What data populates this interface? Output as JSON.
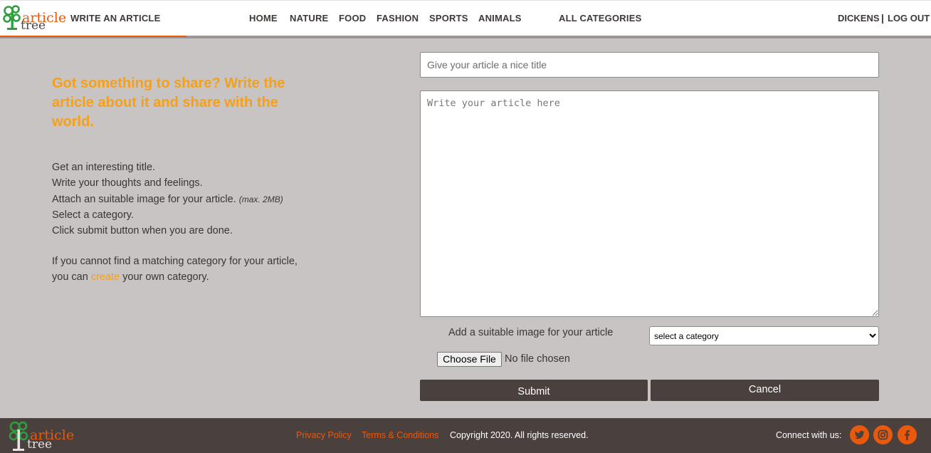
{
  "header": {
    "logo": {
      "line1": "article",
      "line2": "tree"
    },
    "write_link": "WRITE AN ARTICLE",
    "nav": [
      "HOME",
      "NATURE",
      "FOOD",
      "FASHION",
      "SPORTS",
      "ANIMALS",
      "ALL CATEGORIES"
    ],
    "user": "DICKENS",
    "separator": "|",
    "logout": "LOG OUT"
  },
  "info": {
    "headline": "Got something to share? Write the article about it and share with the world.",
    "steps": [
      "Get an interesting title.",
      "Write your thoughts and feelings.",
      "Attach an suitable image for your article.",
      "Select a category.",
      "Click submit button when you are done."
    ],
    "image_note": "(max. 2MB)",
    "find_line1": "If you cannot find a matching category for your article,",
    "find_prefix": "you can",
    "create_link": "create",
    "find_suffix": "your own category."
  },
  "form": {
    "title_placeholder": "Give your article a nice title",
    "body_placeholder": "Write your article here",
    "image_label": "Add a suitable image for your article",
    "category_selected": "select a category",
    "file_button": "Choose File",
    "file_status": "No file chosen",
    "submit": "Submit",
    "cancel": "Cancel"
  },
  "footer": {
    "logo": {
      "line1": "article",
      "line2": "tree"
    },
    "privacy": "Privacy Policy",
    "terms": "Terms & Conditions",
    "copyright": "Copyright 2020. All rights reserved.",
    "connect": "Connect with us:",
    "social_icons": [
      "twitter-icon",
      "instagram-icon",
      "facebook-icon"
    ]
  },
  "colors": {
    "accent": "#e8590c",
    "headline": "#f5a01a",
    "logo_tree": "#2e9e3e",
    "background": "#c8c4c3",
    "dark": "#4a413f"
  }
}
